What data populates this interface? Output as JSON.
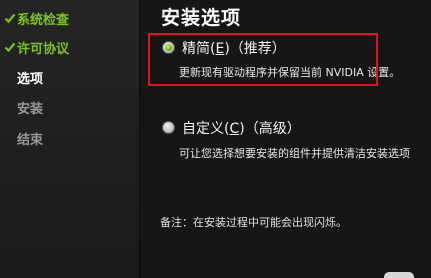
{
  "sidebar": {
    "steps": [
      {
        "label": "系统检查",
        "state": "done"
      },
      {
        "label": "许可协议",
        "state": "done"
      },
      {
        "label": "选项",
        "state": "current"
      },
      {
        "label": "安装",
        "state": "future"
      },
      {
        "label": "结束",
        "state": "future"
      }
    ]
  },
  "main": {
    "title": "安装选项",
    "options": [
      {
        "label_pre": "精简(",
        "label_key": "E",
        "label_post": ")（推荐）",
        "description": "更新现有驱动程序并保留当前 NVIDIA 设置。",
        "selected": true
      },
      {
        "label_pre": "自定义(",
        "label_key": "C",
        "label_post": ")（高级）",
        "description": "可让您选择想要安装的组件并提供清洁安装选项",
        "selected": false
      }
    ],
    "note": "备注：在安装过程中可能会出现闪烁。"
  },
  "colors": {
    "accent_green": "#76b900",
    "done_text": "#7bc41e",
    "highlight_red": "#e0141a",
    "background": "#161616"
  }
}
